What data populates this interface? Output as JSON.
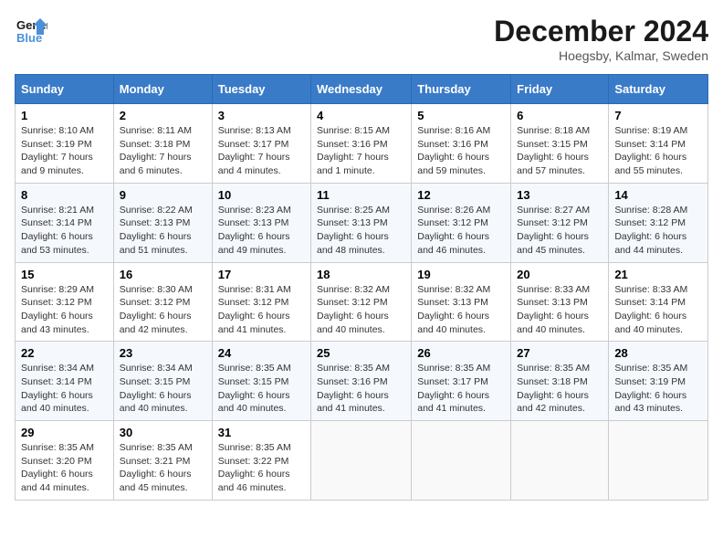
{
  "header": {
    "logo_line1": "General",
    "logo_line2": "Blue",
    "month": "December 2024",
    "location": "Hoegsby, Kalmar, Sweden"
  },
  "weekdays": [
    "Sunday",
    "Monday",
    "Tuesday",
    "Wednesday",
    "Thursday",
    "Friday",
    "Saturday"
  ],
  "weeks": [
    [
      {
        "day": "1",
        "sunrise": "8:10 AM",
        "sunset": "3:19 PM",
        "daylight": "7 hours and 9 minutes."
      },
      {
        "day": "2",
        "sunrise": "8:11 AM",
        "sunset": "3:18 PM",
        "daylight": "7 hours and 6 minutes."
      },
      {
        "day": "3",
        "sunrise": "8:13 AM",
        "sunset": "3:17 PM",
        "daylight": "7 hours and 4 minutes."
      },
      {
        "day": "4",
        "sunrise": "8:15 AM",
        "sunset": "3:16 PM",
        "daylight": "7 hours and 1 minute."
      },
      {
        "day": "5",
        "sunrise": "8:16 AM",
        "sunset": "3:16 PM",
        "daylight": "6 hours and 59 minutes."
      },
      {
        "day": "6",
        "sunrise": "8:18 AM",
        "sunset": "3:15 PM",
        "daylight": "6 hours and 57 minutes."
      },
      {
        "day": "7",
        "sunrise": "8:19 AM",
        "sunset": "3:14 PM",
        "daylight": "6 hours and 55 minutes."
      }
    ],
    [
      {
        "day": "8",
        "sunrise": "8:21 AM",
        "sunset": "3:14 PM",
        "daylight": "6 hours and 53 minutes."
      },
      {
        "day": "9",
        "sunrise": "8:22 AM",
        "sunset": "3:13 PM",
        "daylight": "6 hours and 51 minutes."
      },
      {
        "day": "10",
        "sunrise": "8:23 AM",
        "sunset": "3:13 PM",
        "daylight": "6 hours and 49 minutes."
      },
      {
        "day": "11",
        "sunrise": "8:25 AM",
        "sunset": "3:13 PM",
        "daylight": "6 hours and 48 minutes."
      },
      {
        "day": "12",
        "sunrise": "8:26 AM",
        "sunset": "3:12 PM",
        "daylight": "6 hours and 46 minutes."
      },
      {
        "day": "13",
        "sunrise": "8:27 AM",
        "sunset": "3:12 PM",
        "daylight": "6 hours and 45 minutes."
      },
      {
        "day": "14",
        "sunrise": "8:28 AM",
        "sunset": "3:12 PM",
        "daylight": "6 hours and 44 minutes."
      }
    ],
    [
      {
        "day": "15",
        "sunrise": "8:29 AM",
        "sunset": "3:12 PM",
        "daylight": "6 hours and 43 minutes."
      },
      {
        "day": "16",
        "sunrise": "8:30 AM",
        "sunset": "3:12 PM",
        "daylight": "6 hours and 42 minutes."
      },
      {
        "day": "17",
        "sunrise": "8:31 AM",
        "sunset": "3:12 PM",
        "daylight": "6 hours and 41 minutes."
      },
      {
        "day": "18",
        "sunrise": "8:32 AM",
        "sunset": "3:12 PM",
        "daylight": "6 hours and 40 minutes."
      },
      {
        "day": "19",
        "sunrise": "8:32 AM",
        "sunset": "3:13 PM",
        "daylight": "6 hours and 40 minutes."
      },
      {
        "day": "20",
        "sunrise": "8:33 AM",
        "sunset": "3:13 PM",
        "daylight": "6 hours and 40 minutes."
      },
      {
        "day": "21",
        "sunrise": "8:33 AM",
        "sunset": "3:14 PM",
        "daylight": "6 hours and 40 minutes."
      }
    ],
    [
      {
        "day": "22",
        "sunrise": "8:34 AM",
        "sunset": "3:14 PM",
        "daylight": "6 hours and 40 minutes."
      },
      {
        "day": "23",
        "sunrise": "8:34 AM",
        "sunset": "3:15 PM",
        "daylight": "6 hours and 40 minutes."
      },
      {
        "day": "24",
        "sunrise": "8:35 AM",
        "sunset": "3:15 PM",
        "daylight": "6 hours and 40 minutes."
      },
      {
        "day": "25",
        "sunrise": "8:35 AM",
        "sunset": "3:16 PM",
        "daylight": "6 hours and 41 minutes."
      },
      {
        "day": "26",
        "sunrise": "8:35 AM",
        "sunset": "3:17 PM",
        "daylight": "6 hours and 41 minutes."
      },
      {
        "day": "27",
        "sunrise": "8:35 AM",
        "sunset": "3:18 PM",
        "daylight": "6 hours and 42 minutes."
      },
      {
        "day": "28",
        "sunrise": "8:35 AM",
        "sunset": "3:19 PM",
        "daylight": "6 hours and 43 minutes."
      }
    ],
    [
      {
        "day": "29",
        "sunrise": "8:35 AM",
        "sunset": "3:20 PM",
        "daylight": "6 hours and 44 minutes."
      },
      {
        "day": "30",
        "sunrise": "8:35 AM",
        "sunset": "3:21 PM",
        "daylight": "6 hours and 45 minutes."
      },
      {
        "day": "31",
        "sunrise": "8:35 AM",
        "sunset": "3:22 PM",
        "daylight": "6 hours and 46 minutes."
      },
      null,
      null,
      null,
      null
    ]
  ]
}
